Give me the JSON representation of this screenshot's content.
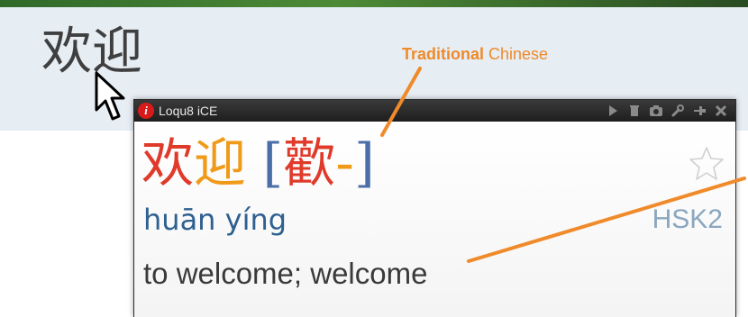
{
  "hero": {
    "word": "欢迎"
  },
  "annotation": {
    "bold": "Traditional",
    "rest": " Chinese",
    "color": "#f08a2a"
  },
  "popup": {
    "app_title": "Loqu8 iCE",
    "info_icon": "i",
    "toolbar_icons": [
      "play-icon",
      "trash-icon",
      "camera-icon",
      "wrench-icon",
      "pin-icon",
      "close-icon"
    ],
    "simplified": [
      "欢",
      "迎"
    ],
    "traditional_open": "[",
    "traditional": [
      "歡",
      "-"
    ],
    "traditional_close": "]",
    "pinyin": "huān yíng",
    "hsk_level": "HSK2",
    "definition": "to welcome; welcome",
    "colors": {
      "tone1": "#e03a2a",
      "tone2": "#f09a1a",
      "pinyin": "#2e6090",
      "bracket": "#4a6fa8"
    }
  }
}
